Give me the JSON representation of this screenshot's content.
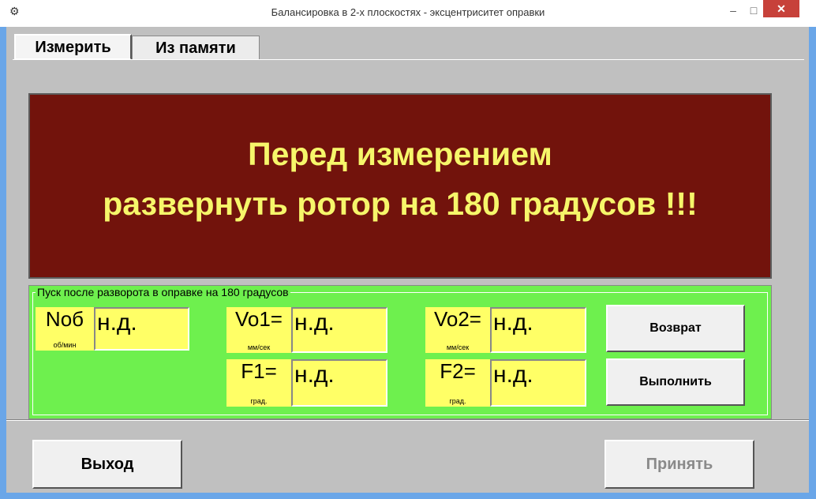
{
  "window": {
    "title": "Балансировка  в 2-х плоскостях - эксцентриситет оправки",
    "minimize_glyph": "–",
    "maximize_glyph": "□",
    "close_glyph": "✕"
  },
  "tabs": [
    {
      "label": "Измерить",
      "active": true
    },
    {
      "label": "Из памяти",
      "active": false
    }
  ],
  "banner": {
    "line1": "Перед измерением",
    "line2": "развернуть ротор на 180 градусов !!!",
    "bg_color": "#72130c",
    "text_color": "#f6f66a"
  },
  "group": {
    "legend": "Пуск после разворота в оправке на 180 градусов",
    "bg_color": "#6ef04e",
    "fields": {
      "nob": {
        "symbol": "Nоб",
        "unit": "об/мин",
        "value": "н.д."
      },
      "vo1": {
        "symbol": "Vo1=",
        "unit": "мм/сек",
        "value": "н.д."
      },
      "vo2": {
        "symbol": "Vo2=",
        "unit": "мм/сек",
        "value": "н.д."
      },
      "f1": {
        "symbol": "F1=",
        "unit": "град.",
        "value": "н.д."
      },
      "f2": {
        "symbol": "F2=",
        "unit": "град.",
        "value": "н.д."
      }
    },
    "buttons": {
      "back": "Возврат",
      "execute": "Выполнить"
    }
  },
  "footer": {
    "exit": "Выход",
    "accept": "Принять",
    "accept_enabled": false
  },
  "icons": {
    "app": "gear-icon"
  }
}
